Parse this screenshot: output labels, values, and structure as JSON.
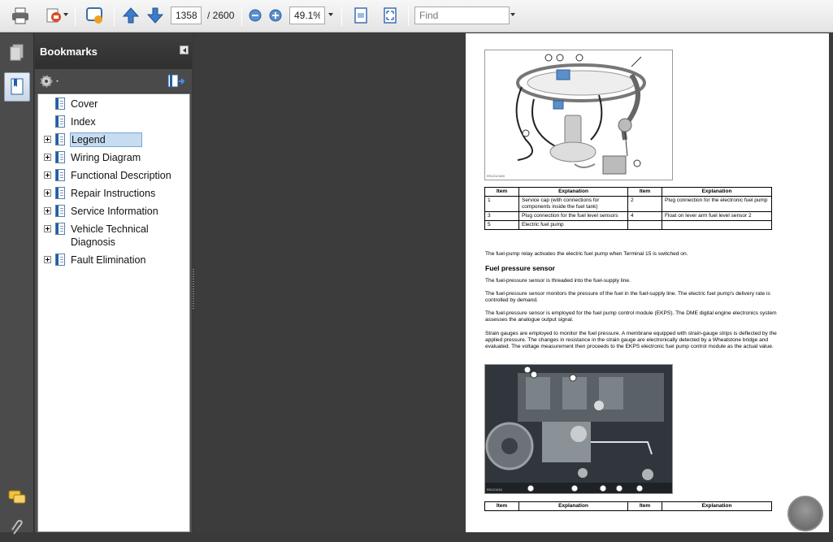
{
  "toolbar": {
    "page_current": "1358",
    "page_separator": "/ 2600",
    "zoom": "49.1%",
    "find_placeholder": "Find"
  },
  "bookmarks": {
    "title": "Bookmarks",
    "items": [
      {
        "label": "Cover",
        "expandable": false
      },
      {
        "label": "Index",
        "expandable": false
      },
      {
        "label": "Legend",
        "expandable": true,
        "selected": true
      },
      {
        "label": "Wiring Diagram",
        "expandable": true
      },
      {
        "label": "Functional Description",
        "expandable": true
      },
      {
        "label": "Repair Instructions",
        "expandable": true
      },
      {
        "label": "Service Information",
        "expandable": true
      },
      {
        "label": "Vehicle Technical",
        "label2": "Diagnosis",
        "expandable": true
      },
      {
        "label": "Fault Elimination",
        "expandable": true
      }
    ]
  },
  "document": {
    "fig1_id": "RS131C469",
    "table1": {
      "headers": [
        "Item",
        "Explanation",
        "Item",
        "Explanation"
      ],
      "rows": [
        [
          "1",
          "Service cap (with connections for components inside the fuel tank)",
          "2",
          "Plug connection for the electronic fuel pump"
        ],
        [
          "3",
          "Plug connection for the fuel level sensors",
          "4",
          "Float on lever arm fuel level sensor 2"
        ],
        [
          "5",
          "Electric fuel pump",
          "",
          ""
        ]
      ]
    },
    "para1": "The fuel-pump relay activates the electric fuel pump when Terminal 15 is switched on.",
    "heading": "Fuel pressure sensor",
    "para2": "The fuel-pressure sensor is threaded into the fuel-supply line.",
    "para3": "The fuel-pressure sensor monitors the pressure of the fuel in the fuel-supply line. The electric fuel pump's delivery rate is controlled by demand.",
    "para4": "The fuel-pressure sensor is employed for the fuel pump control module (EKPS). The DME digital engine electronics system assesses the analogue output signal.",
    "para5": "Strain gauges are employed to monitor the fuel pressure. A membrane equipped with strain-gauge strips is deflected by the applied pressure. The changes in resistance in the strain gauge are electronically detected by a Wheatstone bridge and evaluated. The voltage measurement then proceeds to the EKPS electronic fuel pump control module as the actual value.",
    "fig2_id": "RS121010",
    "table2": {
      "headers": [
        "Item",
        "Explanation",
        "Item",
        "Explanation"
      ]
    }
  },
  "colors": {
    "accent": "#1e5fa8",
    "selection": "#c6dcf1",
    "panel": "#505050"
  }
}
